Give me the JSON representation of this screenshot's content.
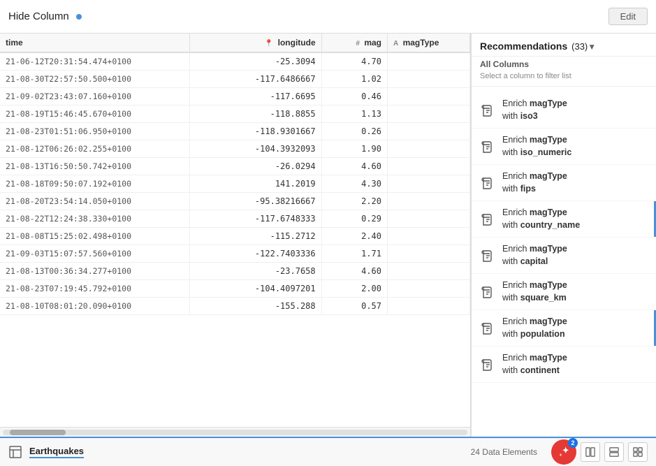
{
  "toolbar": {
    "title": "Hide Column",
    "dot": true,
    "edit_label": "Edit"
  },
  "columns": [
    {
      "id": "time",
      "label": "time",
      "icon": "",
      "type": "text"
    },
    {
      "id": "longitude",
      "label": "longitude",
      "icon": "📍",
      "type": "number"
    },
    {
      "id": "mag",
      "label": "mag",
      "icon": "#",
      "type": "number"
    },
    {
      "id": "magType",
      "label": "magType",
      "icon": "A",
      "type": "text"
    }
  ],
  "rows": [
    {
      "time": "21-06-12T20:31:54.474+0100",
      "longitude": "-25.3094",
      "mag": "4.70",
      "magType": ""
    },
    {
      "time": "21-08-30T22:57:50.500+0100",
      "longitude": "-117.6486667",
      "mag": "1.02",
      "magType": ""
    },
    {
      "time": "21-09-02T23:43:07.160+0100",
      "longitude": "-117.6695",
      "mag": "0.46",
      "magType": ""
    },
    {
      "time": "21-08-19T15:46:45.670+0100",
      "longitude": "-118.8855",
      "mag": "1.13",
      "magType": ""
    },
    {
      "time": "21-08-23T01:51:06.950+0100",
      "longitude": "-118.9301667",
      "mag": "0.26",
      "magType": ""
    },
    {
      "time": "21-08-12T06:26:02.255+0100",
      "longitude": "-104.3932093",
      "mag": "1.90",
      "magType": ""
    },
    {
      "time": "21-08-13T16:50:50.742+0100",
      "longitude": "-26.0294",
      "mag": "4.60",
      "magType": ""
    },
    {
      "time": "21-08-18T09:50:07.192+0100",
      "longitude": "141.2019",
      "mag": "4.30",
      "magType": ""
    },
    {
      "time": "21-08-20T23:54:14.050+0100",
      "longitude": "-95.38216667",
      "mag": "2.20",
      "magType": ""
    },
    {
      "time": "21-08-22T12:24:38.330+0100",
      "longitude": "-117.6748333",
      "mag": "0.29",
      "magType": ""
    },
    {
      "time": "21-08-08T15:25:02.498+0100",
      "longitude": "-115.2712",
      "mag": "2.40",
      "magType": ""
    },
    {
      "time": "21-09-03T15:07:57.560+0100",
      "longitude": "-122.7403336",
      "mag": "1.71",
      "magType": ""
    },
    {
      "time": "21-08-13T00:36:34.277+0100",
      "longitude": "-23.7658",
      "mag": "4.60",
      "magType": ""
    },
    {
      "time": "21-08-23T07:19:45.792+0100",
      "longitude": "-104.4097201",
      "mag": "2.00",
      "magType": ""
    },
    {
      "time": "21-08-10T08:01:20.090+0100",
      "longitude": "-155.288",
      "mag": "0.57",
      "magType": ""
    }
  ],
  "panel": {
    "title": "Recommendations",
    "count": "(33)",
    "subtitle": "All Columns",
    "filter_hint": "Select a column to filter list",
    "items": [
      {
        "action": "Enrich",
        "column": "magType",
        "with": "iso3"
      },
      {
        "action": "Enrich",
        "column": "magType",
        "with": "iso_numeric"
      },
      {
        "action": "Enrich",
        "column": "magType",
        "with": "fips"
      },
      {
        "action": "Enrich",
        "column": "magType",
        "with": "country_name"
      },
      {
        "action": "Enrich",
        "column": "magType",
        "with": "capital"
      },
      {
        "action": "Enrich",
        "column": "magType",
        "with": "square_km"
      },
      {
        "action": "Enrich",
        "column": "magType",
        "with": "population"
      },
      {
        "action": "Enrich",
        "column": "magType",
        "with": "continent"
      }
    ]
  },
  "status_bar": {
    "sheet_name": "Earthquakes",
    "data_elements": "24 Data Elements",
    "badge_count": "2"
  }
}
